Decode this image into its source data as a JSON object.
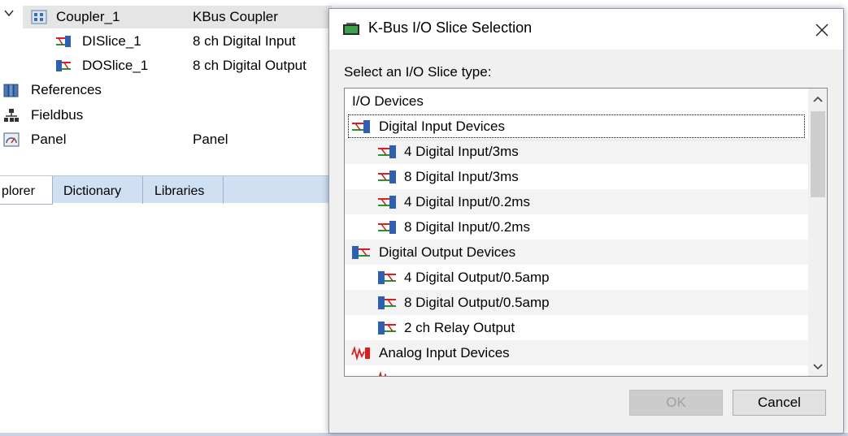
{
  "tree": {
    "rows": [
      {
        "label": "Coupler_1",
        "value": "KBus Coupler"
      },
      {
        "label": "DISlice_1",
        "value": "8 ch Digital Input"
      },
      {
        "label": "DOSlice_1",
        "value": "8 ch Digital Output"
      },
      {
        "label": "References",
        "value": ""
      },
      {
        "label": "Fieldbus",
        "value": ""
      },
      {
        "label": "Panel",
        "value": "Panel"
      }
    ],
    "tabs": [
      "plorer",
      "Dictionary",
      "Libraries"
    ]
  },
  "dialog": {
    "title": "K-Bus I/O Slice Selection",
    "prompt": "Select an I/O Slice type:",
    "items": [
      {
        "label": "I/O Devices",
        "icon": "none"
      },
      {
        "label": "Digital Input Devices",
        "icon": "digital-input-group-icon"
      },
      {
        "label": "4 Digital Input/3ms",
        "icon": "digital-input-icon"
      },
      {
        "label": "8 Digital Input/3ms",
        "icon": "digital-input-icon"
      },
      {
        "label": "4 Digital Input/0.2ms",
        "icon": "digital-input-icon"
      },
      {
        "label": "8 Digital Input/0.2ms",
        "icon": "digital-input-icon"
      },
      {
        "label": "Digital Output Devices",
        "icon": "digital-output-group-icon"
      },
      {
        "label": "4 Digital Output/0.5amp",
        "icon": "digital-output-icon"
      },
      {
        "label": "8 Digital Output/0.5amp",
        "icon": "digital-output-icon"
      },
      {
        "label": "2 ch Relay Output",
        "icon": "digital-output-icon"
      },
      {
        "label": "Analog Input Devices",
        "icon": "analog-input-group-icon"
      }
    ],
    "ok_label": "OK",
    "cancel_label": "Cancel"
  },
  "colors": {
    "tab_bar": "#cfe0f3",
    "selection_gray": "#e5e5e5",
    "scroll_thumb": "#cdcdcd"
  }
}
